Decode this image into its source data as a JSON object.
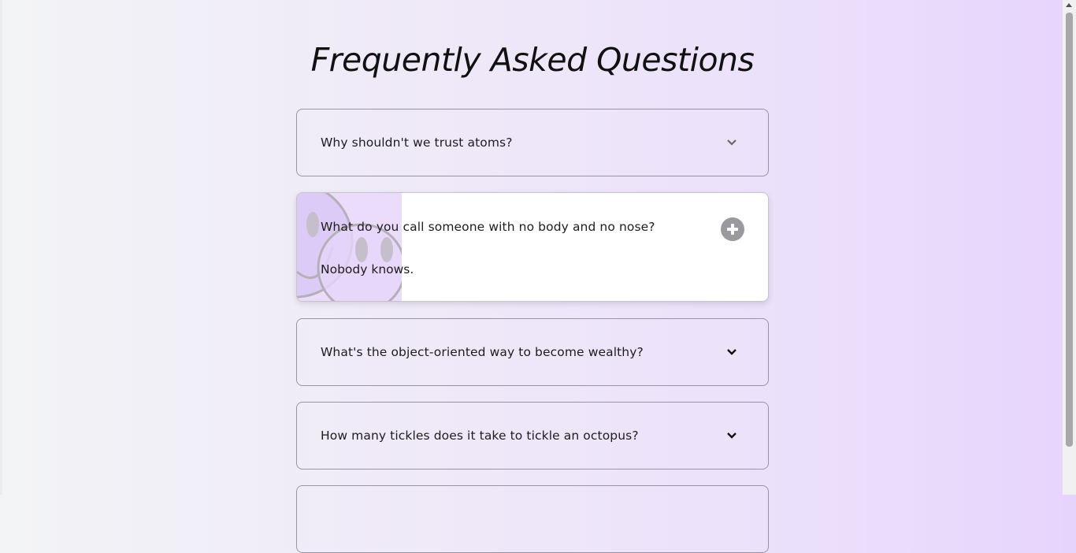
{
  "page": {
    "title": "Frequently Asked Questions"
  },
  "faq": {
    "items": [
      {
        "question": "Why shouldn't we trust atoms?",
        "expanded": false
      },
      {
        "question": "What do you call someone with no body and no nose?",
        "answer": "Nobody knows.",
        "expanded": true
      },
      {
        "question": "What's the object-oriented way to become wealthy?",
        "expanded": false
      },
      {
        "question": "How many tickles does it take to tickle an octopus?",
        "expanded": false
      }
    ]
  },
  "icons": {
    "collapsed": "chevron-down-icon",
    "expanded": "plus-icon",
    "decoration": "smiley-face-illustration"
  },
  "colors": {
    "accent": "#e7d4fd",
    "card_border": "#9b93a3",
    "toggle_bg": "#9a9a9e"
  }
}
